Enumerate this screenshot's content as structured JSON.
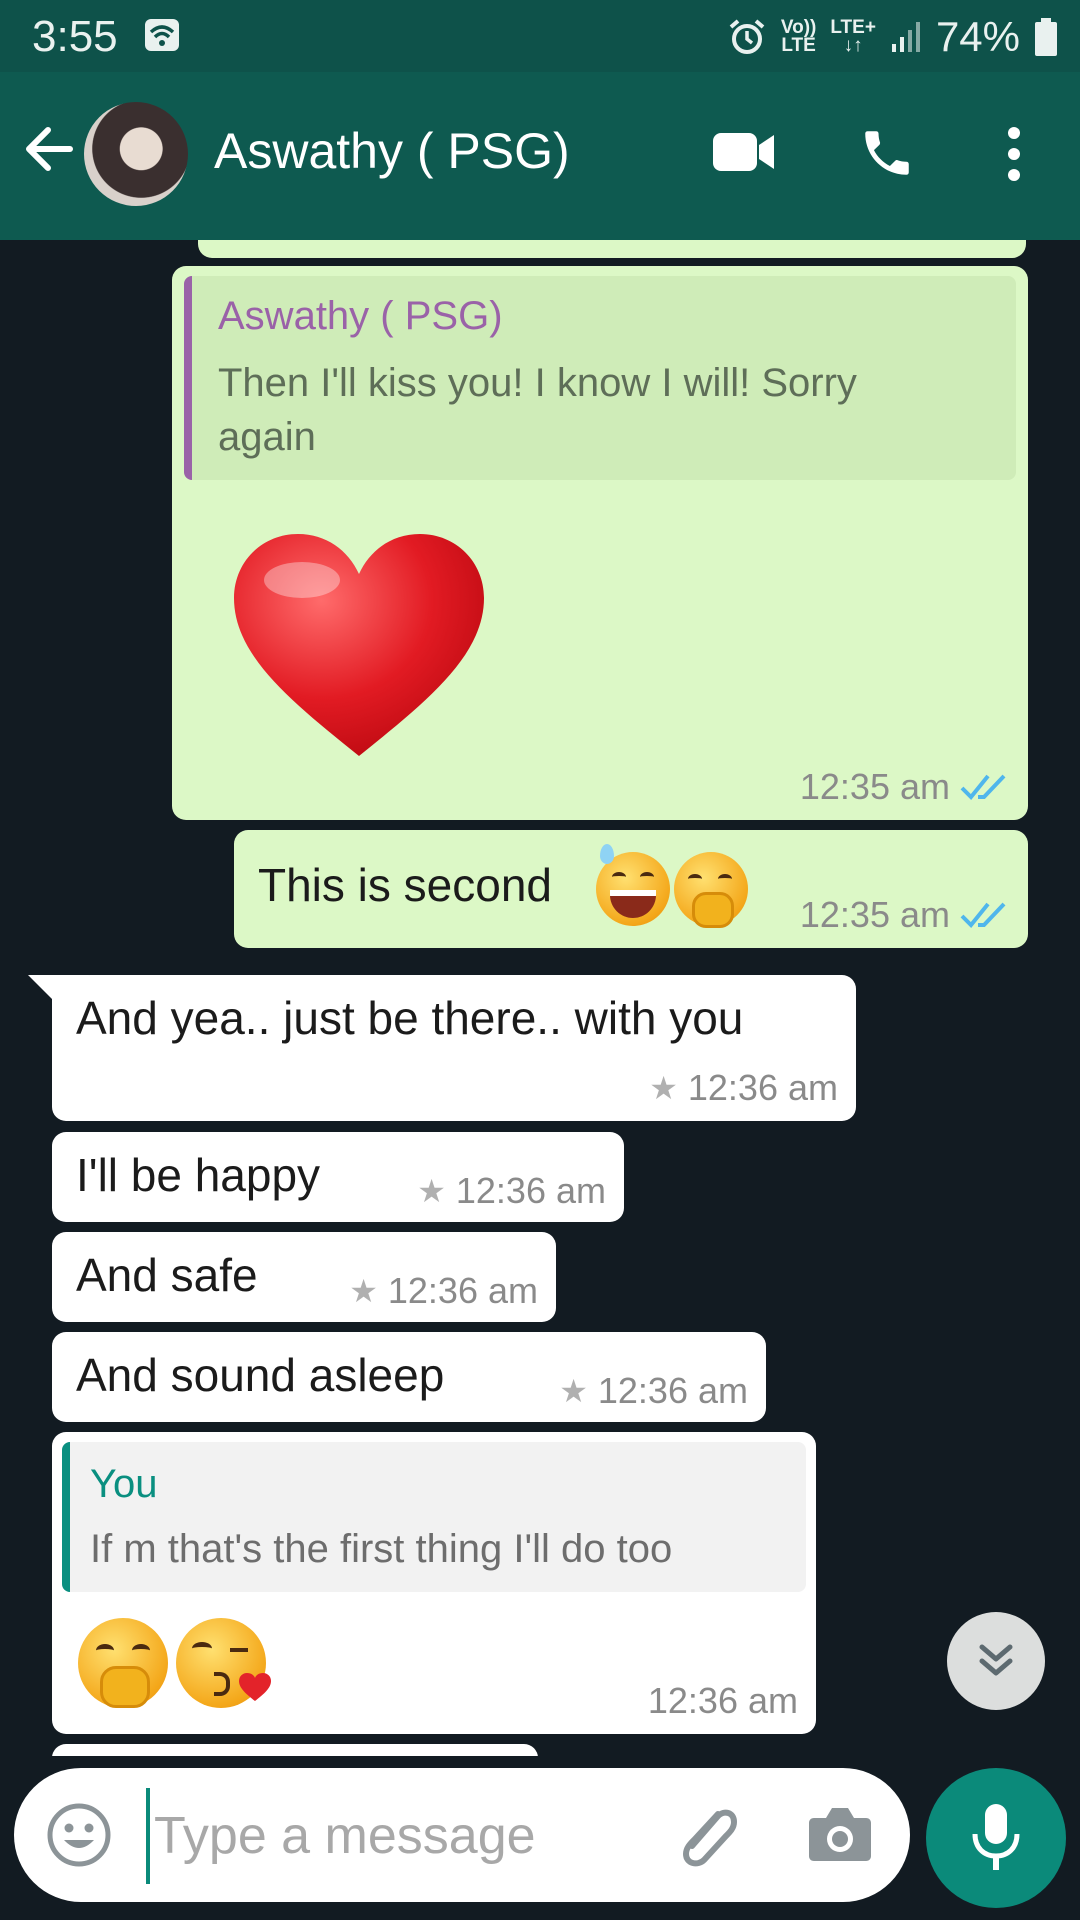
{
  "status_bar": {
    "time": "3:55",
    "volte_top": "Vo))",
    "volte_bottom": "LTE",
    "lte_top": "LTE+",
    "lte_bottom": "↓↑",
    "battery": "74%"
  },
  "header": {
    "contact_name": "Aswathy ( PSG)"
  },
  "messages": [
    {
      "direction": "outgoing",
      "reply_to": {
        "name": "Aswathy ( PSG)",
        "text_line1": "Then I'll kiss you! I know I will! Sorry",
        "text_line2": "again"
      },
      "emoji": "heart",
      "time": "12:35 am",
      "status": "read"
    },
    {
      "direction": "outgoing",
      "text": "This is second",
      "emojis": [
        "grinning-sweat",
        "hand-over-mouth"
      ],
      "time": "12:35 am",
      "status": "read"
    },
    {
      "direction": "incoming",
      "text": "And yea.. just be there.. with you",
      "time": "12:36 am",
      "starred": true
    },
    {
      "direction": "incoming",
      "text": "I'll be happy",
      "time": "12:36 am",
      "starred": true
    },
    {
      "direction": "incoming",
      "text": "And safe",
      "time": "12:36 am",
      "starred": true
    },
    {
      "direction": "incoming",
      "text": "And sound asleep",
      "time": "12:36 am",
      "starred": true
    },
    {
      "direction": "incoming",
      "reply_to": {
        "name": "You",
        "text": "If m that's the first thing I'll do too"
      },
      "emojis": [
        "hand-over-mouth",
        "kissing-heart"
      ],
      "time": "12:36 am"
    }
  ],
  "input": {
    "placeholder": "Type a message"
  },
  "colors": {
    "status_bar": "#0e524a",
    "app_bar": "#0e5a50",
    "chat_background": "#121b22",
    "outgoing_bubble": "#dcf8c6",
    "incoming_bubble": "#ffffff",
    "read_ticks": "#4fb6ec",
    "accent": "#0b8a7a",
    "quoted_contact_name": "#9a62a8",
    "quoted_self_name": "#0a8f80"
  },
  "icons": [
    "wifi-icon",
    "alarm-icon",
    "signal-icon",
    "battery-icon",
    "back-icon",
    "video-call-icon",
    "voice-call-icon",
    "more-options-icon",
    "double-tick-icon",
    "star-icon",
    "chevron-double-down-icon",
    "emoji-icon",
    "attach-icon",
    "camera-icon",
    "mic-icon"
  ]
}
